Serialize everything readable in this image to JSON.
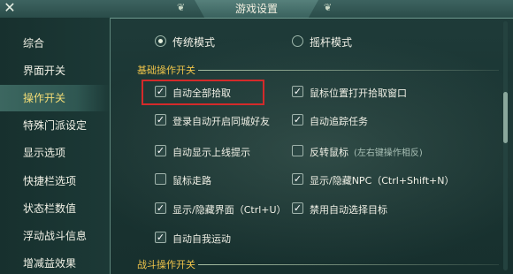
{
  "window": {
    "title": "游戏设置"
  },
  "sidebar": {
    "items": [
      {
        "label": "综合"
      },
      {
        "label": "界面开关"
      },
      {
        "label": "操作开关",
        "active": true
      },
      {
        "label": "特殊门派设定"
      },
      {
        "label": "显示选项"
      },
      {
        "label": "快捷栏选项"
      },
      {
        "label": "状态栏数值"
      },
      {
        "label": "浮动战斗信息"
      },
      {
        "label": "增减益效果"
      }
    ]
  },
  "mode": {
    "options": [
      {
        "label": "传统模式",
        "selected": true
      },
      {
        "label": "摇杆模式",
        "selected": false
      }
    ]
  },
  "sections": {
    "basic": "基础操作开关",
    "combat": "战斗操作开关"
  },
  "checkboxes": [
    {
      "label": "自动全部拾取",
      "checked": true
    },
    {
      "label": "鼠标位置打开拾取窗口",
      "checked": true
    },
    {
      "label": "登录自动开启同城好友",
      "checked": true
    },
    {
      "label": "自动追踪任务",
      "checked": true
    },
    {
      "label": "自动显示上线提示",
      "checked": true
    },
    {
      "label": "反转鼠标",
      "note": "(左右键操作相反)",
      "checked": false
    },
    {
      "label": "鼠标走路",
      "checked": false
    },
    {
      "label": "显示/隐藏NPC（Ctrl+Shift+N）",
      "checked": true
    },
    {
      "label": "显示/隐藏界面（Ctrl+U）",
      "checked": true
    },
    {
      "label": "禁用自动选择目标",
      "checked": true
    },
    {
      "label": "自动自我运动",
      "checked": true
    }
  ],
  "icons": {
    "check": "✓",
    "close": "✕"
  },
  "colors": {
    "accent_gold": "#efc44a",
    "highlight_red": "#d42a2a",
    "active_text": "#f3dd76"
  }
}
